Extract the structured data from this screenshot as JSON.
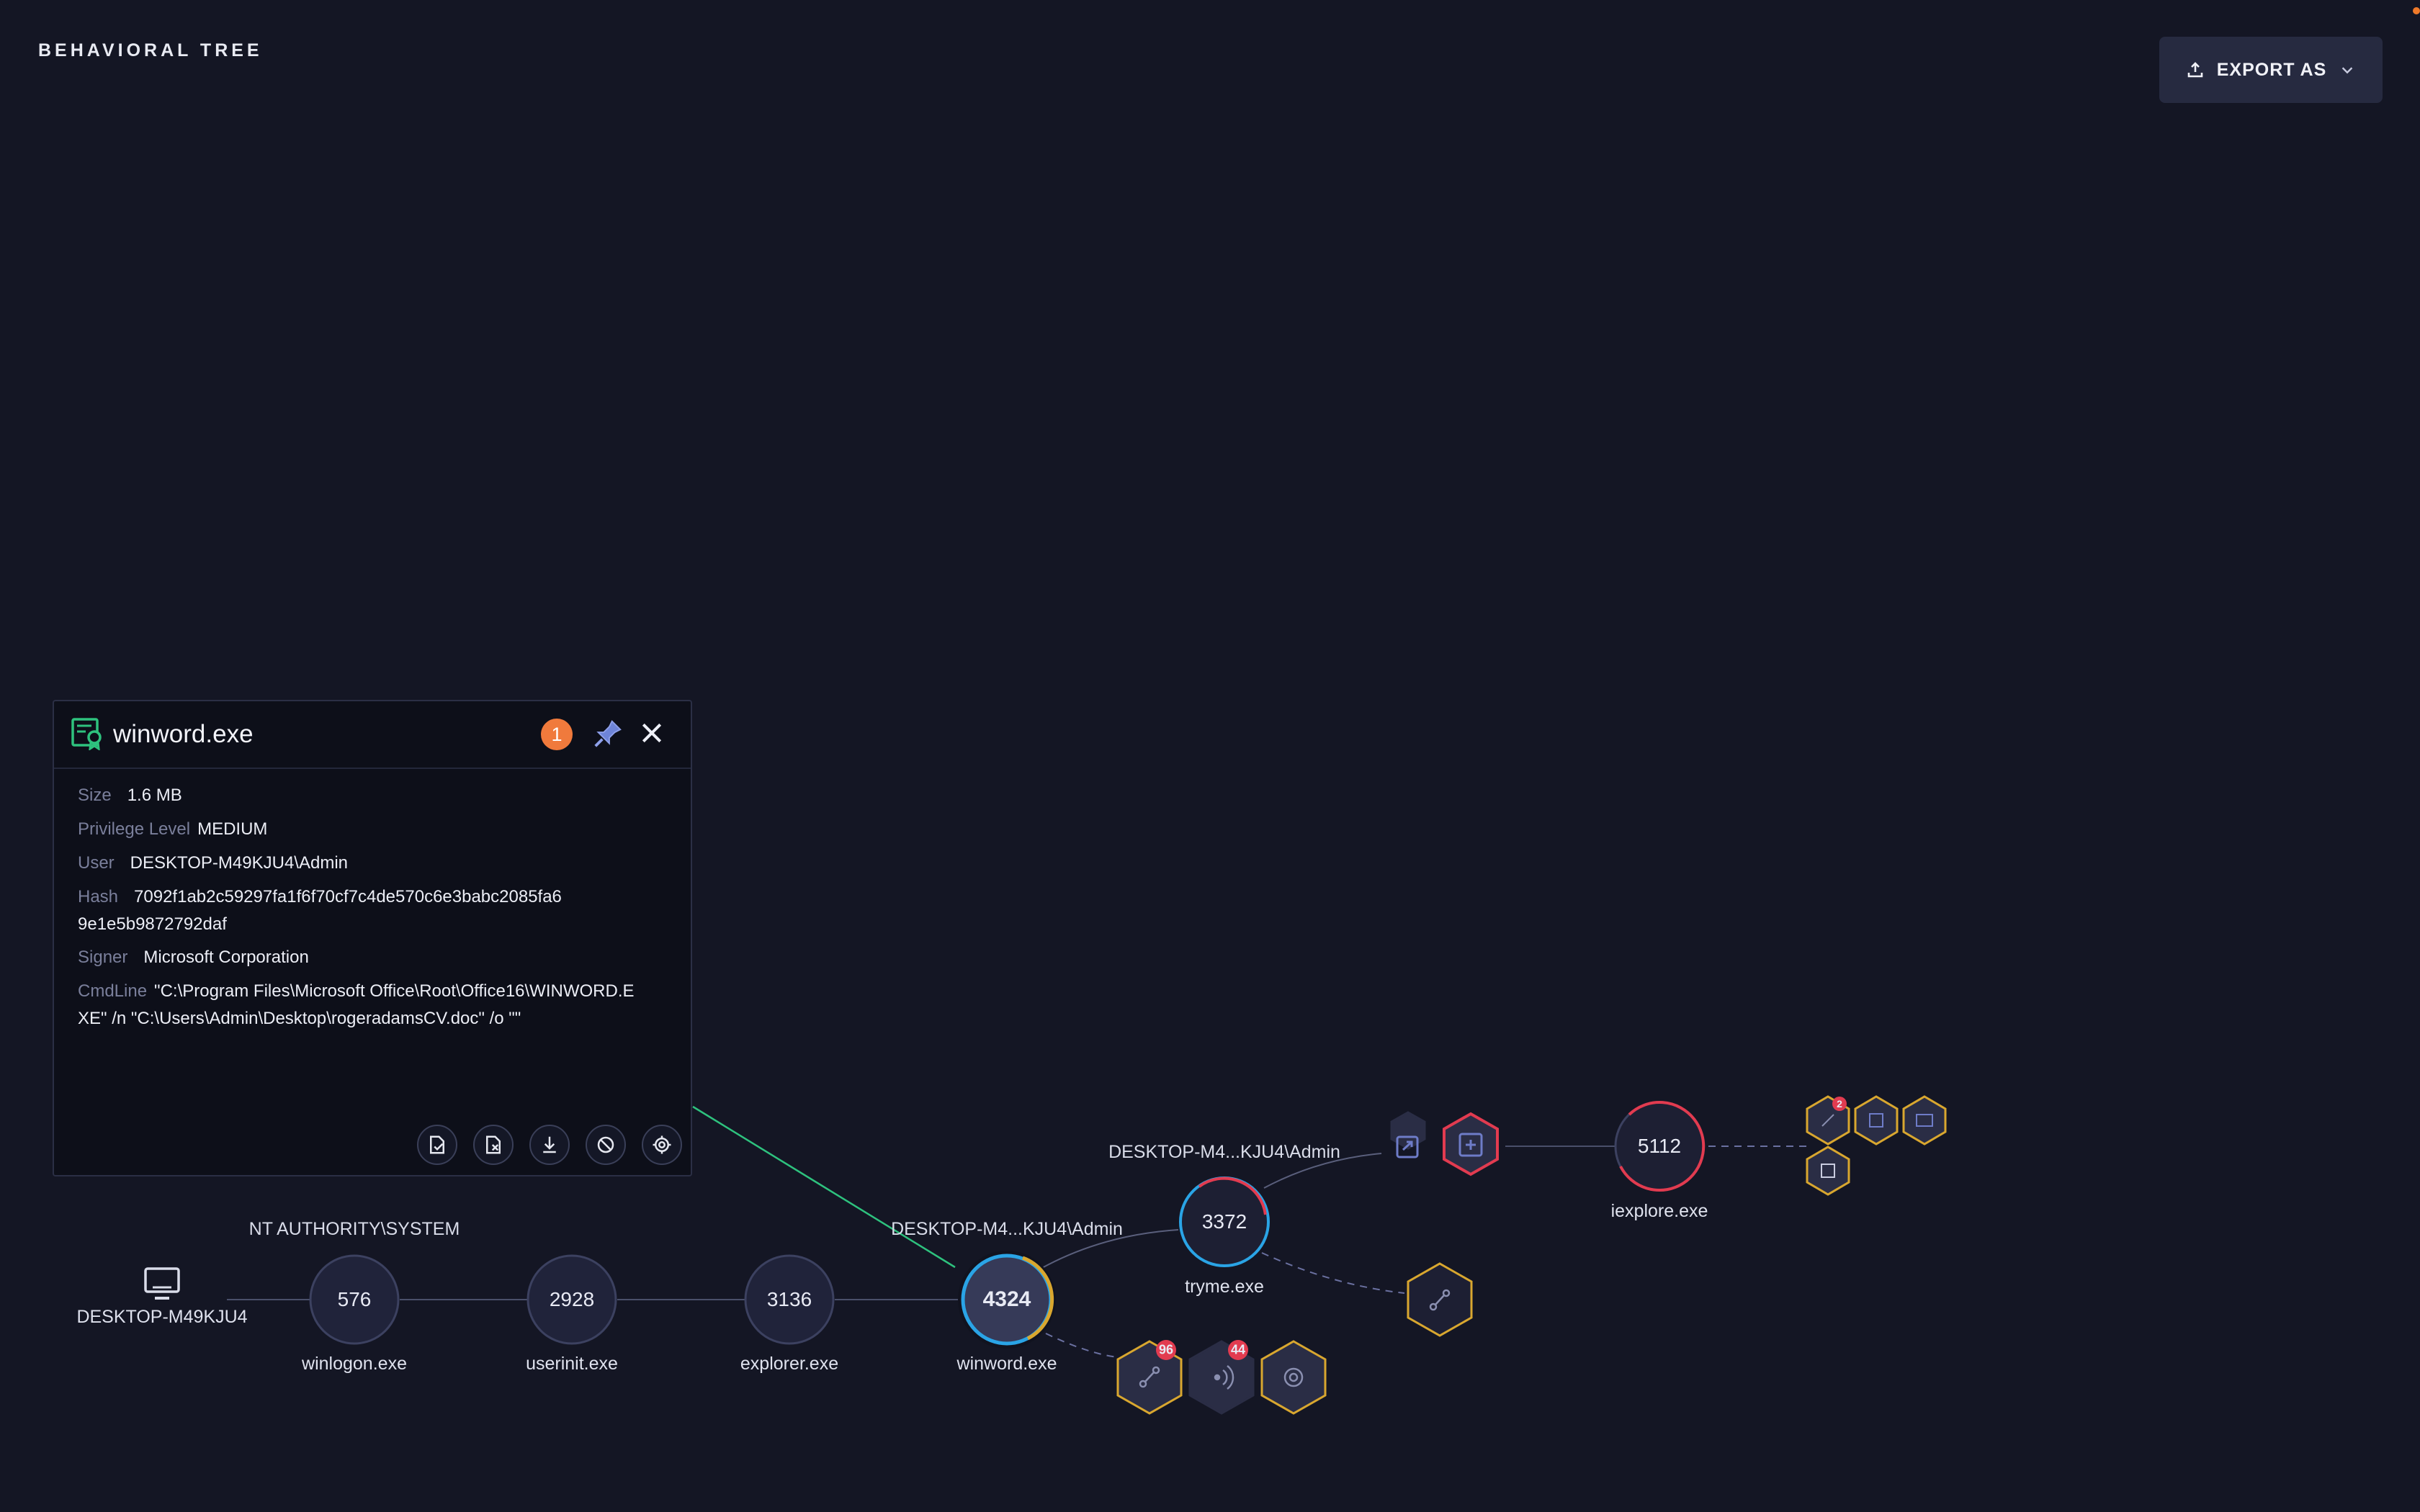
{
  "header": {
    "title": "BEHAVIORAL TREE",
    "export_label": "EXPORT AS"
  },
  "colors": {
    "background": "#141624",
    "accent_red": "#e23b50",
    "accent_blue": "#2aa4e6",
    "accent_yellow": "#d9a72f",
    "accent_green": "#2ec27e",
    "badge_orange": "#f07a3c"
  },
  "tree": {
    "host": {
      "label": "DESKTOP-M49KJU4",
      "icon": "desktop-icon"
    },
    "users": {
      "system": "NT AUTHORITY\\SYSTEM",
      "admin_winword": "DESKTOP-M4...KJU4\\Admin",
      "admin_tryme": "DESKTOP-M4...KJU4\\Admin"
    },
    "processes": [
      {
        "pid": "576",
        "name": "winlogon.exe"
      },
      {
        "pid": "2928",
        "name": "userinit.exe"
      },
      {
        "pid": "3136",
        "name": "explorer.exe"
      },
      {
        "pid": "4324",
        "name": "winword.exe"
      },
      {
        "pid": "3372",
        "name": "tryme.exe"
      },
      {
        "pid": "5112",
        "name": "iexplore.exe"
      }
    ],
    "badges": {
      "winword_network": "96",
      "winword_signal": "44",
      "iexplore_network": "2"
    }
  },
  "panel": {
    "title": "winword.exe",
    "alert_count": "1",
    "props": {
      "size_label": "Size",
      "size": "1.6 MB",
      "privilege_label": "Privilege Level",
      "privilege": "MEDIUM",
      "user_label": "User",
      "user": "DESKTOP-M49KJU4\\Admin",
      "hash_label": "Hash",
      "hash": "7092f1ab2c59297fa1f6f70cf7c4de570c6e3babc2085fa6 9e1e5b9872792daf",
      "signer_label": "Signer",
      "signer": "Microsoft Corporation",
      "cmdline_label": "CmdLine",
      "cmdline": "\"C:\\Program Files\\Microsoft Office\\Root\\Office16\\WINWORD.EXE\" /n \"C:\\Users\\Admin\\Desktop\\rogeradamsCV.doc\" /o \"\""
    },
    "actions": [
      "allow-file-icon",
      "block-file-icon",
      "download-icon",
      "prevent-icon",
      "locate-icon"
    ]
  }
}
